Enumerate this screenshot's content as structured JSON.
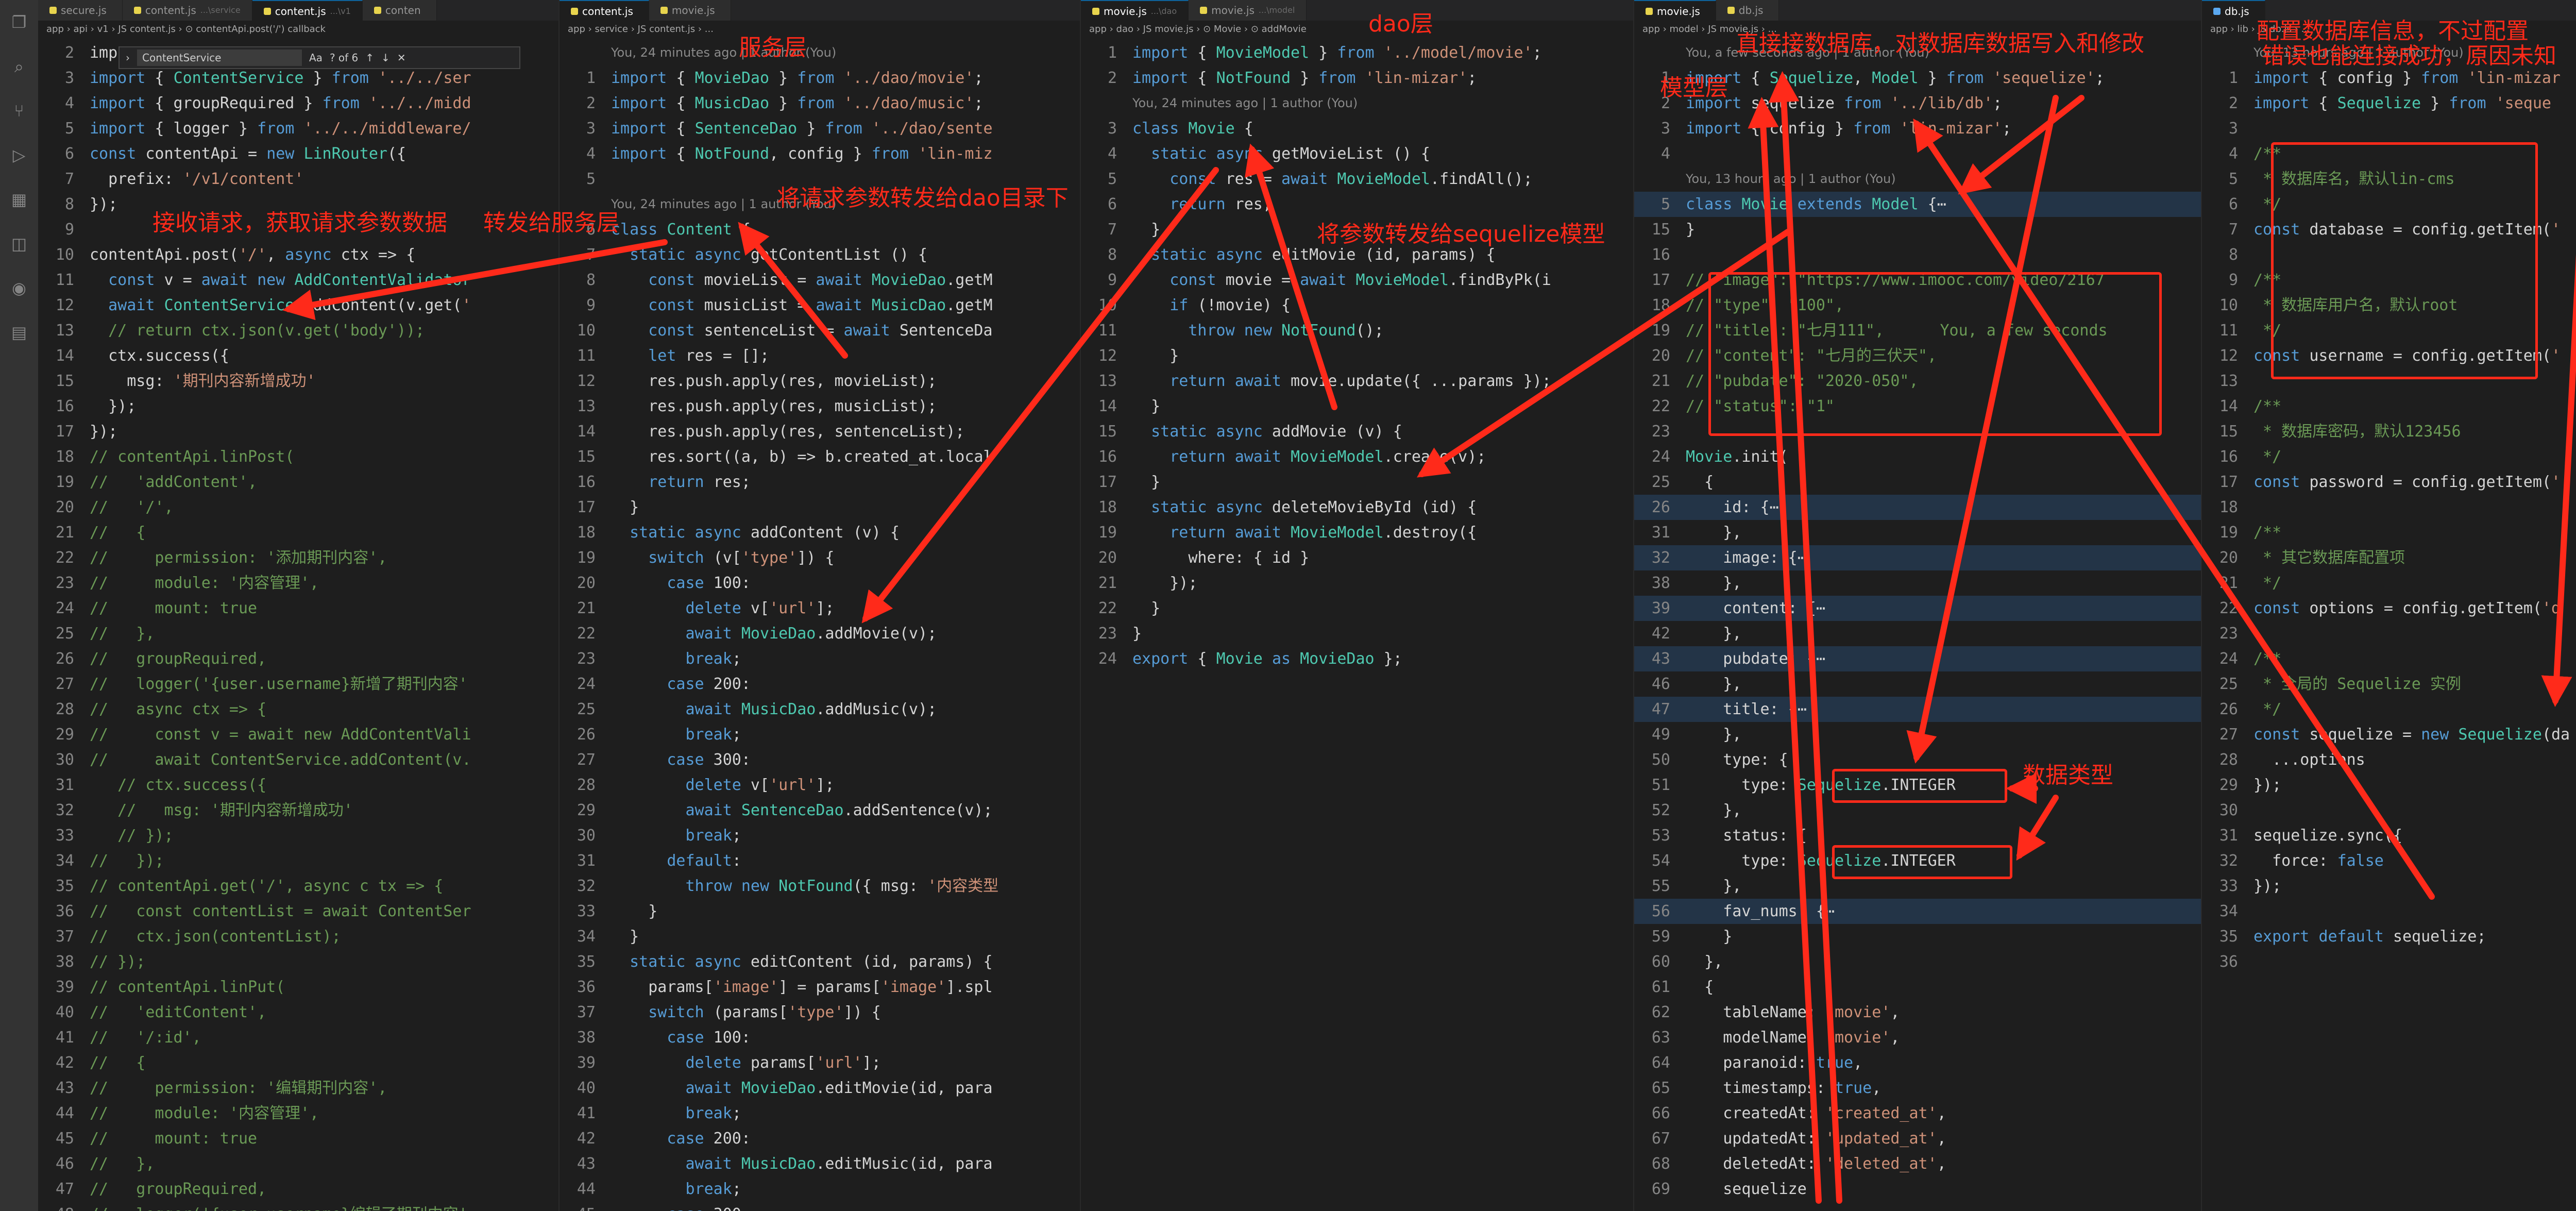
{
  "panes": [
    {
      "tabs": [
        {
          "name": "secure.js",
          "sub": "",
          "icon": "js"
        },
        {
          "name": "content.js",
          "sub": "...\\service",
          "icon": "js"
        },
        {
          "name": "content.js",
          "sub": "...\\v1",
          "icon": "js",
          "active": true
        },
        {
          "name": "conten",
          "sub": "",
          "icon": "js"
        }
      ],
      "breadcrumb": "app › api › v1 › JS content.js › ⊙ contentApi.post('/') callback",
      "find": {
        "value": "ContentService",
        "status": "? of 6"
      },
      "lines": [
        {
          "n": "2",
          "t": "imp"
        },
        {
          "n": "3",
          "t": "import { ContentService } from '../../ser"
        },
        {
          "n": "4",
          "t": "import { groupRequired } from '../../midd"
        },
        {
          "n": "5",
          "t": "import { logger } from '../../middleware/"
        },
        {
          "n": "6",
          "t": "const contentApi = new LinRouter({"
        },
        {
          "n": "7",
          "t": "  prefix: '/v1/content'"
        },
        {
          "n": "8",
          "t": "});"
        },
        {
          "n": "9",
          "t": ""
        },
        {
          "n": "10",
          "t": "contentApi.post('/', async ctx => {"
        },
        {
          "n": "11",
          "t": "  const v = await new AddContentValidator"
        },
        {
          "n": "12",
          "t": "  await ContentService.addContent(v.get('"
        },
        {
          "n": "13",
          "t": "  // return ctx.json(v.get('body'));"
        },
        {
          "n": "14",
          "t": "  ctx.success({"
        },
        {
          "n": "15",
          "t": "    msg: '期刊内容新增成功'"
        },
        {
          "n": "16",
          "t": "  });"
        },
        {
          "n": "17",
          "t": "});"
        },
        {
          "n": "18",
          "t": "// contentApi.linPost("
        },
        {
          "n": "19",
          "t": "//   'addContent',"
        },
        {
          "n": "20",
          "t": "//   '/',"
        },
        {
          "n": "21",
          "t": "//   {"
        },
        {
          "n": "22",
          "t": "//     permission: '添加期刊内容',"
        },
        {
          "n": "23",
          "t": "//     module: '内容管理',"
        },
        {
          "n": "24",
          "t": "//     mount: true"
        },
        {
          "n": "25",
          "t": "//   },"
        },
        {
          "n": "26",
          "t": "//   groupRequired,"
        },
        {
          "n": "27",
          "t": "//   logger('{user.username}新增了期刊内容'"
        },
        {
          "n": "28",
          "t": "//   async ctx => {"
        },
        {
          "n": "29",
          "t": "//     const v = await new AddContentVali"
        },
        {
          "n": "30",
          "t": "//     await ContentService.addContent(v."
        },
        {
          "n": "31",
          "t": "   // ctx.success({"
        },
        {
          "n": "32",
          "t": "   //   msg: '期刊内容新增成功'"
        },
        {
          "n": "33",
          "t": "   // });"
        },
        {
          "n": "34",
          "t": "//   });"
        },
        {
          "n": "35",
          "t": "// contentApi.get('/', async c tx => {"
        },
        {
          "n": "36",
          "t": "//   const contentList = await ContentSer"
        },
        {
          "n": "37",
          "t": "//   ctx.json(contentList);"
        },
        {
          "n": "38",
          "t": "// });"
        },
        {
          "n": "39",
          "t": "// contentApi.linPut("
        },
        {
          "n": "40",
          "t": "//   'editContent',"
        },
        {
          "n": "41",
          "t": "//   '/:id',"
        },
        {
          "n": "42",
          "t": "//   {"
        },
        {
          "n": "43",
          "t": "//     permission: '编辑期刊内容',"
        },
        {
          "n": "44",
          "t": "//     module: '内容管理',"
        },
        {
          "n": "45",
          "t": "//     mount: true"
        },
        {
          "n": "46",
          "t": "//   },"
        },
        {
          "n": "47",
          "t": "//   groupRequired,"
        },
        {
          "n": "48",
          "t": "//   logger('{user.username}编辑了期刊内容'"
        }
      ]
    },
    {
      "tabs": [
        {
          "name": "content.js",
          "sub": "",
          "icon": "js",
          "active": true
        },
        {
          "name": "movie.js",
          "sub": "",
          "icon": "js"
        }
      ],
      "breadcrumb": "app › service › JS content.js › ...",
      "lines": [
        {
          "n": "",
          "t": "You, 24 minutes ago | 1 author (You)",
          "ann": true
        },
        {
          "n": "1",
          "t": "import { MovieDao } from '../dao/movie';"
        },
        {
          "n": "2",
          "t": "import { MusicDao } from '../dao/music';"
        },
        {
          "n": "3",
          "t": "import { SentenceDao } from '../dao/sente"
        },
        {
          "n": "4",
          "t": "import { NotFound, config } from 'lin-miz"
        },
        {
          "n": "5",
          "t": ""
        },
        {
          "n": "",
          "t": "You, 24 minutes ago | 1 author (You)",
          "ann": true
        },
        {
          "n": "6",
          "t": "class Content {"
        },
        {
          "n": "7",
          "t": "  static async getContentList () {"
        },
        {
          "n": "8",
          "t": "    const movieList = await MovieDao.getM"
        },
        {
          "n": "9",
          "t": "    const musicList = await MusicDao.getM"
        },
        {
          "n": "10",
          "t": "    const sentenceList = await SentenceDa"
        },
        {
          "n": "11",
          "t": "    let res = [];"
        },
        {
          "n": "12",
          "t": "    res.push.apply(res, movieList);"
        },
        {
          "n": "13",
          "t": "    res.push.apply(res, musicList);"
        },
        {
          "n": "14",
          "t": "    res.push.apply(res, sentenceList);"
        },
        {
          "n": "15",
          "t": "    res.sort((a, b) => b.created_at.local"
        },
        {
          "n": "16",
          "t": "    return res;"
        },
        {
          "n": "17",
          "t": "  }"
        },
        {
          "n": "18",
          "t": "  static async addContent (v) {"
        },
        {
          "n": "19",
          "t": "    switch (v['type']) {"
        },
        {
          "n": "20",
          "t": "      case 100:"
        },
        {
          "n": "21",
          "t": "        delete v['url'];"
        },
        {
          "n": "22",
          "t": "        await MovieDao.addMovie(v);"
        },
        {
          "n": "23",
          "t": "        break;"
        },
        {
          "n": "24",
          "t": "      case 200:"
        },
        {
          "n": "25",
          "t": "        await MusicDao.addMusic(v);"
        },
        {
          "n": "26",
          "t": "        break;"
        },
        {
          "n": "27",
          "t": "      case 300:"
        },
        {
          "n": "28",
          "t": "        delete v['url'];"
        },
        {
          "n": "29",
          "t": "        await SentenceDao.addSentence(v);"
        },
        {
          "n": "30",
          "t": "        break;"
        },
        {
          "n": "31",
          "t": "      default:"
        },
        {
          "n": "32",
          "t": "        throw new NotFound({ msg: '内容类型"
        },
        {
          "n": "33",
          "t": "    }"
        },
        {
          "n": "34",
          "t": "  }"
        },
        {
          "n": "35",
          "t": "  static async editContent (id, params) {"
        },
        {
          "n": "36",
          "t": "    params['image'] = params['image'].spl"
        },
        {
          "n": "37",
          "t": "    switch (params['type']) {"
        },
        {
          "n": "38",
          "t": "      case 100:"
        },
        {
          "n": "39",
          "t": "        delete params['url'];"
        },
        {
          "n": "40",
          "t": "        await MovieDao.editMovie(id, para"
        },
        {
          "n": "41",
          "t": "        break;"
        },
        {
          "n": "42",
          "t": "      case 200:"
        },
        {
          "n": "43",
          "t": "        await MusicDao.editMusic(id, para"
        },
        {
          "n": "44",
          "t": "        break;"
        },
        {
          "n": "45",
          "t": "      case 300:"
        }
      ]
    },
    {
      "tabs": [
        {
          "name": "movie.js",
          "sub": "...\\dao",
          "icon": "js",
          "active": true
        },
        {
          "name": "movie.js",
          "sub": "...\\model",
          "icon": "js"
        }
      ],
      "breadcrumb": "app › dao › JS movie.js › ⊙ Movie › ⊙ addMovie",
      "lines": [
        {
          "n": "1",
          "t": "import { MovieModel } from '../model/movie';"
        },
        {
          "n": "2",
          "t": "import { NotFound } from 'lin-mizar';"
        },
        {
          "n": "",
          "t": "You, 24 minutes ago | 1 author (You)",
          "ann": true
        },
        {
          "n": "3",
          "t": "class Movie {"
        },
        {
          "n": "4",
          "t": "  static async getMovieList () {"
        },
        {
          "n": "5",
          "t": "    const res = await MovieModel.findAll();"
        },
        {
          "n": "6",
          "t": "    return res;"
        },
        {
          "n": "7",
          "t": "  }"
        },
        {
          "n": "8",
          "t": "  static async editMovie (id, params) {"
        },
        {
          "n": "9",
          "t": "    const movie = await MovieModel.findByPk(i"
        },
        {
          "n": "10",
          "t": "    if (!movie) {"
        },
        {
          "n": "11",
          "t": "      throw new NotFound();"
        },
        {
          "n": "12",
          "t": "    }"
        },
        {
          "n": "13",
          "t": "    return await movie.update({ ...params });"
        },
        {
          "n": "14",
          "t": "  }"
        },
        {
          "n": "15",
          "t": "  static async addMovie (v) {"
        },
        {
          "n": "16",
          "t": "    return await MovieModel.create(v);"
        },
        {
          "n": "17",
          "t": "  }"
        },
        {
          "n": "18",
          "t": "  static async deleteMovieById (id) {"
        },
        {
          "n": "19",
          "t": "    return await MovieModel.destroy({"
        },
        {
          "n": "20",
          "t": "      where: { id }"
        },
        {
          "n": "21",
          "t": "    });"
        },
        {
          "n": "22",
          "t": "  }"
        },
        {
          "n": "23",
          "t": "}"
        },
        {
          "n": "24",
          "t": "export { Movie as MovieDao };"
        }
      ]
    },
    {
      "tabs": [
        {
          "name": "movie.js",
          "sub": "",
          "icon": "js",
          "active": true
        },
        {
          "name": "db.js",
          "sub": "",
          "icon": "js"
        }
      ],
      "breadcrumb": "app › model › JS movie.js › ...",
      "lines": [
        {
          "n": "",
          "t": "You, a few seconds ago | 1 author (You)",
          "ann": true
        },
        {
          "n": "1",
          "t": "import { Sequelize, Model } from 'sequelize';"
        },
        {
          "n": "2",
          "t": "import sequelize from '../lib/db';"
        },
        {
          "n": "3",
          "t": "import { config } from 'lin-mizar';"
        },
        {
          "n": "4",
          "t": ""
        },
        {
          "n": "",
          "t": "You, 13 hours ago | 1 author (You)",
          "ann": true
        },
        {
          "n": "5",
          "t": "class Movie extends Model {⋯",
          "fold": true
        },
        {
          "n": "15",
          "t": "}"
        },
        {
          "n": "16",
          "t": ""
        },
        {
          "n": "17",
          "t": "// \"image\": \"https://www.imooc.com/video/2167"
        },
        {
          "n": "18",
          "t": "// \"type\": \"100\","
        },
        {
          "n": "19",
          "t": "// \"title\": \"七月111\",      You, a few seconds"
        },
        {
          "n": "20",
          "t": "// \"content\": \"七月的三伏天\","
        },
        {
          "n": "21",
          "t": "// \"pubdate\": \"2020-050\","
        },
        {
          "n": "22",
          "t": "// \"status\": \"1\""
        },
        {
          "n": "23",
          "t": ""
        },
        {
          "n": "24",
          "t": "Movie.init("
        },
        {
          "n": "25",
          "t": "  {"
        },
        {
          "n": "26",
          "t": "    id: {⋯",
          "fold": true
        },
        {
          "n": "31",
          "t": "    },"
        },
        {
          "n": "32",
          "t": "    image: {⋯",
          "fold": true
        },
        {
          "n": "38",
          "t": "    },"
        },
        {
          "n": "39",
          "t": "    content: {⋯",
          "fold": true
        },
        {
          "n": "42",
          "t": "    },"
        },
        {
          "n": "43",
          "t": "    pubdate: {⋯",
          "fold": true
        },
        {
          "n": "46",
          "t": "    },"
        },
        {
          "n": "47",
          "t": "    title: {⋯",
          "fold": true
        },
        {
          "n": "49",
          "t": "    },"
        },
        {
          "n": "50",
          "t": "    type: {"
        },
        {
          "n": "51",
          "t": "      type: Sequelize.INTEGER"
        },
        {
          "n": "52",
          "t": "    },"
        },
        {
          "n": "53",
          "t": "    status: {"
        },
        {
          "n": "54",
          "t": "      type: Sequelize.INTEGER"
        },
        {
          "n": "55",
          "t": "    },"
        },
        {
          "n": "56",
          "t": "    fav_nums: {⋯",
          "fold": true
        },
        {
          "n": "59",
          "t": "    }"
        },
        {
          "n": "60",
          "t": "  },"
        },
        {
          "n": "61",
          "t": "  {"
        },
        {
          "n": "62",
          "t": "    tableName: 'movie',"
        },
        {
          "n": "63",
          "t": "    modelName: 'movie',"
        },
        {
          "n": "64",
          "t": "    paranoid: true,"
        },
        {
          "n": "65",
          "t": "    timestamps: true,"
        },
        {
          "n": "66",
          "t": "    createdAt: 'created_at',"
        },
        {
          "n": "67",
          "t": "    updatedAt: 'updated_at',"
        },
        {
          "n": "68",
          "t": "    deletedAt: 'deleted_at',"
        },
        {
          "n": "69",
          "t": "    sequelize"
        }
      ]
    },
    {
      "tabs": [
        {
          "name": "db.js",
          "sub": "",
          "icon": "db",
          "active": true
        }
      ],
      "breadcrumb": "app › lib › JS db.js › ...",
      "lines": [
        {
          "n": "",
          "t": "You, 13 hours ago | 1 author (You)",
          "ann": true
        },
        {
          "n": "1",
          "t": "import { config } from 'lin-mizar"
        },
        {
          "n": "2",
          "t": "import { Sequelize } from 'seque"
        },
        {
          "n": "3",
          "t": ""
        },
        {
          "n": "4",
          "t": "/**"
        },
        {
          "n": "5",
          "t": " * 数据库名，默认lin-cms"
        },
        {
          "n": "6",
          "t": " */"
        },
        {
          "n": "7",
          "t": "const database = config.getItem('"
        },
        {
          "n": "8",
          "t": ""
        },
        {
          "n": "9",
          "t": "/**"
        },
        {
          "n": "10",
          "t": " * 数据库用户名，默认root"
        },
        {
          "n": "11",
          "t": " */"
        },
        {
          "n": "12",
          "t": "const username = config.getItem('"
        },
        {
          "n": "13",
          "t": ""
        },
        {
          "n": "14",
          "t": "/**"
        },
        {
          "n": "15",
          "t": " * 数据库密码，默认123456"
        },
        {
          "n": "16",
          "t": " */"
        },
        {
          "n": "17",
          "t": "const password = config.getItem('"
        },
        {
          "n": "18",
          "t": ""
        },
        {
          "n": "19",
          "t": "/**"
        },
        {
          "n": "20",
          "t": " * 其它数据库配置项"
        },
        {
          "n": "21",
          "t": " */"
        },
        {
          "n": "22",
          "t": "const options = config.getItem('d"
        },
        {
          "n": "23",
          "t": ""
        },
        {
          "n": "24",
          "t": "/**"
        },
        {
          "n": "25",
          "t": " * 全局的 Sequelize 实例"
        },
        {
          "n": "26",
          "t": " */"
        },
        {
          "n": "27",
          "t": "const sequelize = new Sequelize(da"
        },
        {
          "n": "28",
          "t": "  ...options"
        },
        {
          "n": "29",
          "t": "});"
        },
        {
          "n": "30",
          "t": ""
        },
        {
          "n": "31",
          "t": "sequelize.sync({"
        },
        {
          "n": "32",
          "t": "  force: false"
        },
        {
          "n": "33",
          "t": "});"
        },
        {
          "n": "34",
          "t": ""
        },
        {
          "n": "35",
          "t": "export default sequelize;"
        },
        {
          "n": "36",
          "t": ""
        }
      ]
    }
  ],
  "annotations": {
    "receive_request": "接收请求，获取请求参数数据",
    "to_service": "转发给服务层",
    "service_layer": "服务层",
    "to_dao": "将请求参数转发给dao目录下",
    "dao_layer": "dao层",
    "to_sequelize_model": "将参数转发给sequelize模型",
    "model_layer": "模型层",
    "model_desc": "直接接数据库，对数据库数据写入和修改",
    "config_db": "配置数据库信息，不过配置",
    "config_error": "错误也能连接成功，原因未知",
    "data_type": "数据类型"
  },
  "colors": {
    "annotation_red": "#ff2a1a",
    "editor_bg": "#1e1e1e",
    "keyword": "#569cd6",
    "string": "#ce9178",
    "comment": "#6a9955",
    "class_name": "#4ec9b0",
    "function": "#dcdcaa",
    "variable": "#9cdcfe"
  },
  "activity_icons": [
    "files-icon",
    "search-icon",
    "source-control-icon",
    "run-debug-icon",
    "extensions-icon",
    "remote-icon",
    "docker-icon",
    "database-icon"
  ]
}
